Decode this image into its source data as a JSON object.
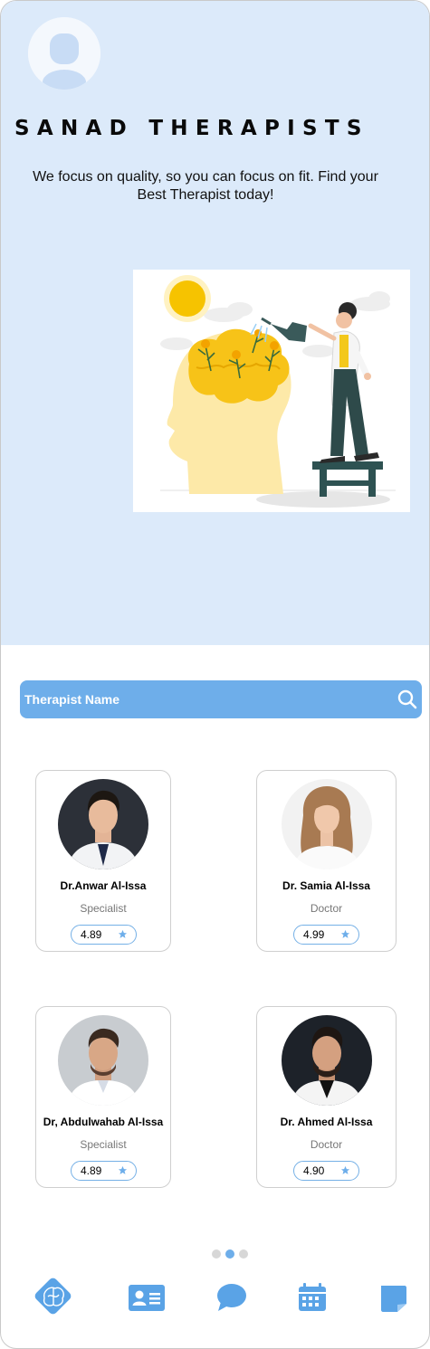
{
  "header": {
    "avatar_icon": "user-avatar-icon",
    "brand": "SANAD THERAPISTS",
    "tagline": "We focus on quality, so you can focus on fit. Find your Best Therapist today!"
  },
  "illustration": {
    "icon": "mind-growth-illustration"
  },
  "search": {
    "placeholder": "Therapist Name",
    "icon": "search-icon"
  },
  "therapists": [
    {
      "name": "Dr.Anwar Al-Issa",
      "role": "Specialist",
      "rating": "4.89"
    },
    {
      "name": "Dr. Samia  Al-Issa",
      "role": "Doctor",
      "rating": "4.99"
    },
    {
      "name": "Dr, Abdulwahab Al-Issa",
      "role": "Specialist",
      "rating": "4.89"
    },
    {
      "name": "Dr. Ahmed Al-Issa",
      "role": "Doctor",
      "rating": "4.90"
    }
  ],
  "pagination": {
    "pages": 3,
    "current": 2
  },
  "nav": {
    "items": [
      {
        "icon": "brain-logo-icon"
      },
      {
        "icon": "contact-card-icon"
      },
      {
        "icon": "chat-bubble-icon"
      },
      {
        "icon": "calendar-icon"
      },
      {
        "icon": "note-icon"
      }
    ]
  },
  "colors": {
    "hero_bg": "#dceafa",
    "accent": "#6eaeea",
    "nav_icon": "#5aa3e6",
    "rating_border": "#75b0e6",
    "star": "#6eaeea"
  }
}
